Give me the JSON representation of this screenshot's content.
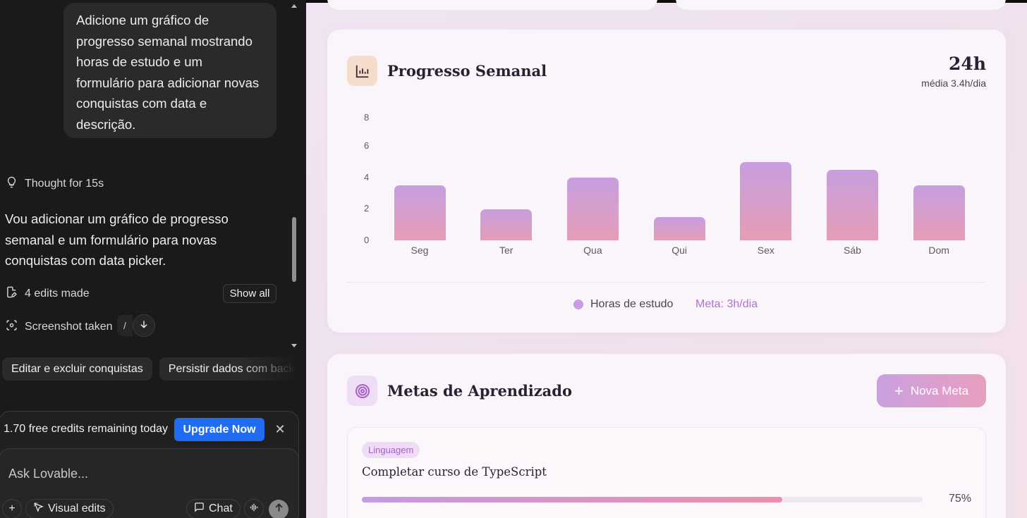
{
  "chat": {
    "user_message": "Adicione um gráfico de progresso semanal mostrando horas de estudo e um formulário para adicionar novas conquistas com data e descrição.",
    "thought": "Thought for 15s",
    "reply": "Vou adicionar um gráfico de progresso semanal e um formulário para novas conquistas com data picker.",
    "edits": "4 edits made",
    "show_all": "Show all",
    "screenshot": "Screenshot taken",
    "screenshot_sep": "/",
    "suggestions": [
      "Editar e excluir conquistas",
      "Persistir dados com backend"
    ],
    "credits": "1.70 free credits remaining today",
    "upgrade": "Upgrade Now",
    "placeholder": "Ask Lovable...",
    "visual_edits": "Visual edits",
    "chat_mode": "Chat"
  },
  "progress": {
    "title": "Progresso Semanal",
    "total": "24h",
    "average": "média 3.4h/dia",
    "legend_series": "Horas de estudo",
    "legend_goal": "Meta: 3h/dia"
  },
  "chart_data": {
    "type": "bar",
    "categories": [
      "Seg",
      "Ter",
      "Qua",
      "Qui",
      "Sex",
      "Sáb",
      "Dom"
    ],
    "series": [
      {
        "name": "Horas de estudo",
        "values": [
          3.5,
          2,
          4,
          1.5,
          5,
          4.5,
          3.5
        ]
      }
    ],
    "yticks": [
      "8",
      "6",
      "4",
      "2",
      "0"
    ],
    "ylim": [
      0,
      8
    ],
    "colors": {
      "bar_top": "#c79ee0",
      "bar_bottom": "#e59db5"
    }
  },
  "goals": {
    "title": "Metas de Aprendizado",
    "new_button": "Nova Meta",
    "items": [
      {
        "tag": "Linguagem",
        "title": "Completar curso de TypeScript",
        "progress": 75,
        "progress_label": "75%"
      }
    ]
  }
}
